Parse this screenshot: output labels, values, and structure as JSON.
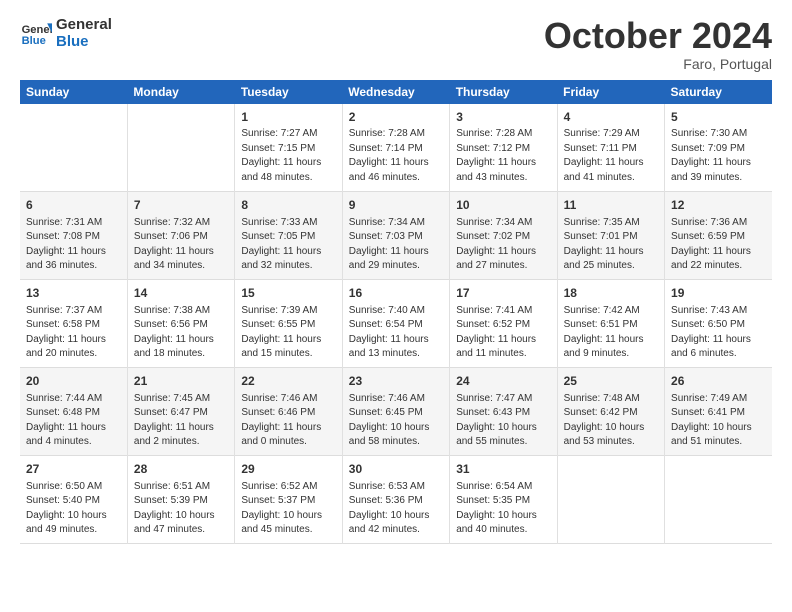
{
  "header": {
    "logo_general": "General",
    "logo_blue": "Blue",
    "month": "October 2024",
    "location": "Faro, Portugal"
  },
  "days_of_week": [
    "Sunday",
    "Monday",
    "Tuesday",
    "Wednesday",
    "Thursday",
    "Friday",
    "Saturday"
  ],
  "weeks": [
    [
      {
        "num": "",
        "info": ""
      },
      {
        "num": "",
        "info": ""
      },
      {
        "num": "1",
        "info": "Sunrise: 7:27 AM\nSunset: 7:15 PM\nDaylight: 11 hours and 48 minutes."
      },
      {
        "num": "2",
        "info": "Sunrise: 7:28 AM\nSunset: 7:14 PM\nDaylight: 11 hours and 46 minutes."
      },
      {
        "num": "3",
        "info": "Sunrise: 7:28 AM\nSunset: 7:12 PM\nDaylight: 11 hours and 43 minutes."
      },
      {
        "num": "4",
        "info": "Sunrise: 7:29 AM\nSunset: 7:11 PM\nDaylight: 11 hours and 41 minutes."
      },
      {
        "num": "5",
        "info": "Sunrise: 7:30 AM\nSunset: 7:09 PM\nDaylight: 11 hours and 39 minutes."
      }
    ],
    [
      {
        "num": "6",
        "info": "Sunrise: 7:31 AM\nSunset: 7:08 PM\nDaylight: 11 hours and 36 minutes."
      },
      {
        "num": "7",
        "info": "Sunrise: 7:32 AM\nSunset: 7:06 PM\nDaylight: 11 hours and 34 minutes."
      },
      {
        "num": "8",
        "info": "Sunrise: 7:33 AM\nSunset: 7:05 PM\nDaylight: 11 hours and 32 minutes."
      },
      {
        "num": "9",
        "info": "Sunrise: 7:34 AM\nSunset: 7:03 PM\nDaylight: 11 hours and 29 minutes."
      },
      {
        "num": "10",
        "info": "Sunrise: 7:34 AM\nSunset: 7:02 PM\nDaylight: 11 hours and 27 minutes."
      },
      {
        "num": "11",
        "info": "Sunrise: 7:35 AM\nSunset: 7:01 PM\nDaylight: 11 hours and 25 minutes."
      },
      {
        "num": "12",
        "info": "Sunrise: 7:36 AM\nSunset: 6:59 PM\nDaylight: 11 hours and 22 minutes."
      }
    ],
    [
      {
        "num": "13",
        "info": "Sunrise: 7:37 AM\nSunset: 6:58 PM\nDaylight: 11 hours and 20 minutes."
      },
      {
        "num": "14",
        "info": "Sunrise: 7:38 AM\nSunset: 6:56 PM\nDaylight: 11 hours and 18 minutes."
      },
      {
        "num": "15",
        "info": "Sunrise: 7:39 AM\nSunset: 6:55 PM\nDaylight: 11 hours and 15 minutes."
      },
      {
        "num": "16",
        "info": "Sunrise: 7:40 AM\nSunset: 6:54 PM\nDaylight: 11 hours and 13 minutes."
      },
      {
        "num": "17",
        "info": "Sunrise: 7:41 AM\nSunset: 6:52 PM\nDaylight: 11 hours and 11 minutes."
      },
      {
        "num": "18",
        "info": "Sunrise: 7:42 AM\nSunset: 6:51 PM\nDaylight: 11 hours and 9 minutes."
      },
      {
        "num": "19",
        "info": "Sunrise: 7:43 AM\nSunset: 6:50 PM\nDaylight: 11 hours and 6 minutes."
      }
    ],
    [
      {
        "num": "20",
        "info": "Sunrise: 7:44 AM\nSunset: 6:48 PM\nDaylight: 11 hours and 4 minutes."
      },
      {
        "num": "21",
        "info": "Sunrise: 7:45 AM\nSunset: 6:47 PM\nDaylight: 11 hours and 2 minutes."
      },
      {
        "num": "22",
        "info": "Sunrise: 7:46 AM\nSunset: 6:46 PM\nDaylight: 11 hours and 0 minutes."
      },
      {
        "num": "23",
        "info": "Sunrise: 7:46 AM\nSunset: 6:45 PM\nDaylight: 10 hours and 58 minutes."
      },
      {
        "num": "24",
        "info": "Sunrise: 7:47 AM\nSunset: 6:43 PM\nDaylight: 10 hours and 55 minutes."
      },
      {
        "num": "25",
        "info": "Sunrise: 7:48 AM\nSunset: 6:42 PM\nDaylight: 10 hours and 53 minutes."
      },
      {
        "num": "26",
        "info": "Sunrise: 7:49 AM\nSunset: 6:41 PM\nDaylight: 10 hours and 51 minutes."
      }
    ],
    [
      {
        "num": "27",
        "info": "Sunrise: 6:50 AM\nSunset: 5:40 PM\nDaylight: 10 hours and 49 minutes."
      },
      {
        "num": "28",
        "info": "Sunrise: 6:51 AM\nSunset: 5:39 PM\nDaylight: 10 hours and 47 minutes."
      },
      {
        "num": "29",
        "info": "Sunrise: 6:52 AM\nSunset: 5:37 PM\nDaylight: 10 hours and 45 minutes."
      },
      {
        "num": "30",
        "info": "Sunrise: 6:53 AM\nSunset: 5:36 PM\nDaylight: 10 hours and 42 minutes."
      },
      {
        "num": "31",
        "info": "Sunrise: 6:54 AM\nSunset: 5:35 PM\nDaylight: 10 hours and 40 minutes."
      },
      {
        "num": "",
        "info": ""
      },
      {
        "num": "",
        "info": ""
      }
    ]
  ]
}
